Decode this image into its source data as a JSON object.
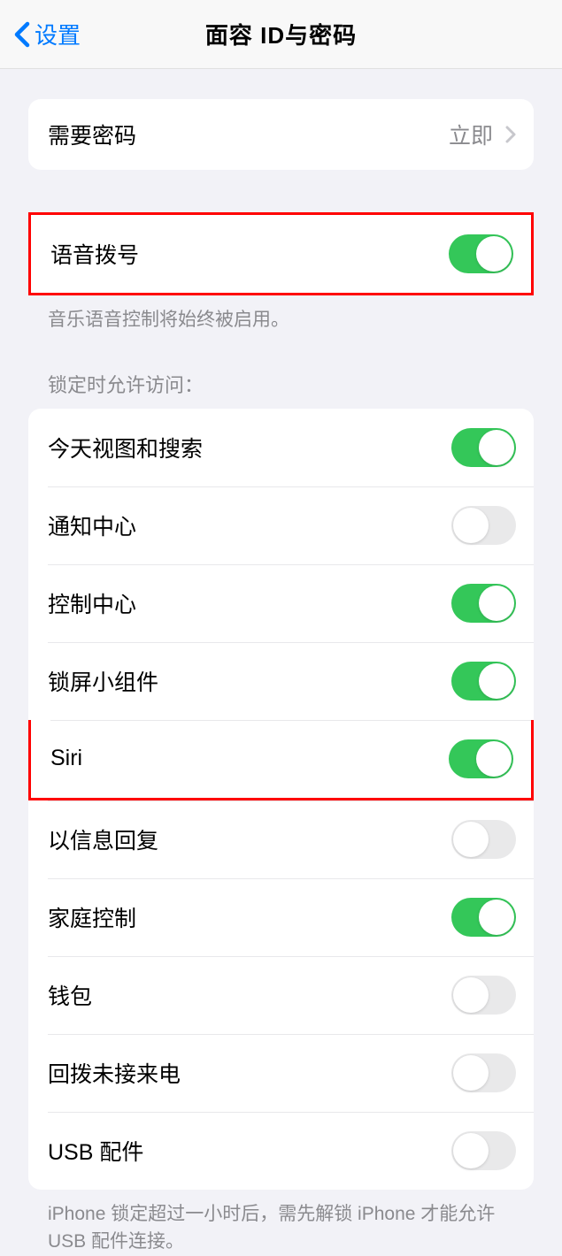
{
  "header": {
    "back_label": "设置",
    "title": "面容 ID与密码"
  },
  "require_passcode": {
    "label": "需要密码",
    "value": "立即"
  },
  "voice_dial": {
    "label": "语音拨号",
    "footer": "音乐语音控制将始终被启用。"
  },
  "lock_access": {
    "header": "锁定时允许访问：",
    "items": [
      {
        "label": "今天视图和搜索",
        "on": true
      },
      {
        "label": "通知中心",
        "on": false
      },
      {
        "label": "控制中心",
        "on": true
      },
      {
        "label": "锁屏小组件",
        "on": true
      },
      {
        "label": "Siri",
        "on": true
      },
      {
        "label": "以信息回复",
        "on": false
      },
      {
        "label": "家庭控制",
        "on": true
      },
      {
        "label": "钱包",
        "on": false
      },
      {
        "label": "回拨未接来电",
        "on": false
      },
      {
        "label": "USB 配件",
        "on": false
      }
    ],
    "footer": "iPhone 锁定超过一小时后，需先解锁 iPhone 才能允许 USB 配件连接。"
  }
}
